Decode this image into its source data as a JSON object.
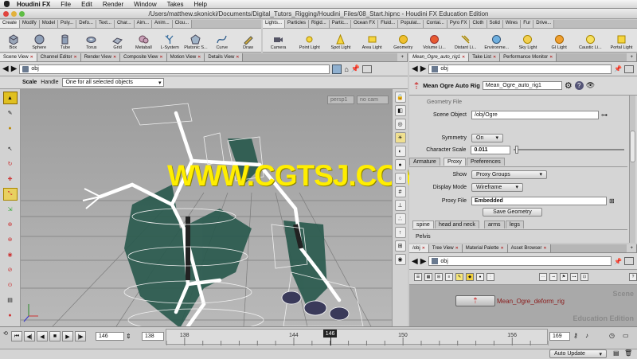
{
  "menubar": {
    "app": "Houdini FX",
    "items": [
      "File",
      "Edit",
      "Render",
      "Window",
      "Takes",
      "Help"
    ]
  },
  "window": {
    "title": "/Users/matthew.skonicki/Documents/Digital_Tutors_Rigging/Houdini_Files/08_Start.hipnc - Houdini FX Education Edition"
  },
  "shelf_left": {
    "tabs": [
      "Create",
      "Modify",
      "Model",
      "Poly...",
      "Defo...",
      "Text...",
      "Char...",
      "Aim...",
      "Anim...",
      "Clou..."
    ],
    "tools": [
      "Box",
      "Sphere",
      "Tube",
      "Torus",
      "Grid",
      "Metaball",
      "L-System",
      "Platonic S...",
      "Curve",
      "Draw"
    ]
  },
  "shelf_right": {
    "tabs": [
      "Lights...",
      "Particles",
      "Rigid...",
      "Partic...",
      "Ocean FX",
      "Fluid...",
      "Populat...",
      "Contai...",
      "Pyro FX",
      "Cloth",
      "Solid",
      "Wires",
      "Fur",
      "Drive..."
    ],
    "tools": [
      "Camera",
      "Point Light",
      "Spot Light",
      "Area Light",
      "Geometry",
      "Volume Li...",
      "Distant Li...",
      "Environme...",
      "Sky Light",
      "GI Light",
      "Caustic Li...",
      "Portal Light"
    ]
  },
  "viewport_tabs": [
    "Scene View",
    "Channel Editor",
    "Render View",
    "Composite View",
    "Motion View",
    "Details View"
  ],
  "viewport": {
    "path": "obj",
    "tool_label": "Scale",
    "handle_label": "Handle",
    "handle_mode": "One for all selected objects",
    "persp": "persp1",
    "cam": "no cam"
  },
  "watermark": "WWW.CGTSJ.COM",
  "param_tabs": [
    "Mean_Ogre_auto_rig1",
    "Take List",
    "Performance Monitor"
  ],
  "params": {
    "path": "obj",
    "node_type": "Mean Ogre Auto Rig",
    "node_name": "Mean_Ogre_auto_rig1",
    "geometry_file_label": "Geometry File",
    "scene_object_label": "Scene Object",
    "scene_object_value": "/obj/Ogre",
    "symmetry_label": "Symmetry",
    "symmetry_value": "On",
    "char_scale_label": "Character Scale",
    "char_scale_value": "0.011",
    "char_scale_fraction": 0.011,
    "tabs": [
      "Armature",
      "Proxy",
      "Preferences"
    ],
    "show_label": "Show",
    "show_value": "Proxy Groups",
    "display_label": "Display Mode",
    "display_value": "Wireframe",
    "proxy_file_label": "Proxy File",
    "proxy_file_value": "Embedded",
    "save_button": "Save Geometry",
    "sub_tabs": [
      "spine",
      "head and neck",
      "arms",
      "legs"
    ],
    "pelvis_label": "Pelvis"
  },
  "network_tabs": [
    "/obj",
    "Tree View",
    "Material Palette",
    "Asset Browser"
  ],
  "network": {
    "path": "obj",
    "node_label": "Mean_Ogre_deform_rig",
    "context_label": "Scene",
    "edition_label": "Education Edition"
  },
  "timeline": {
    "current_frame": "146",
    "start_frame": "138",
    "end_frame": "169",
    "ticks": [
      "138",
      "144",
      "146",
      "150",
      "156"
    ],
    "auto_update": "Auto Update",
    "tick_values": [
      138,
      144,
      150,
      156
    ],
    "range": [
      137,
      158
    ],
    "cursor": 146
  },
  "colors": {
    "watermark": "#ffee00",
    "node_label": "#8a1a1a",
    "geo": "#2a5a4e"
  }
}
